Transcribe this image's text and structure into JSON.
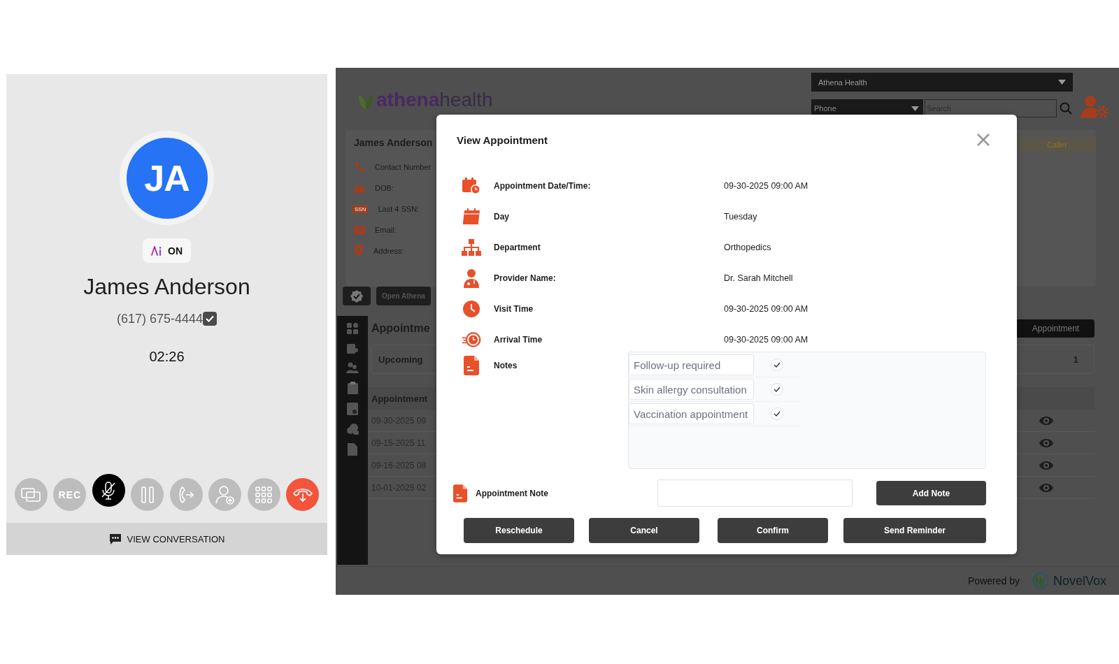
{
  "call_panel": {
    "initials": "JA",
    "ai_status": "ON",
    "caller_name": "James Anderson",
    "phone": "(617) 675-4444",
    "verified": true,
    "timer": "02:26",
    "controls": [
      {
        "kind": "screen",
        "active": false
      },
      {
        "kind": "record",
        "label": "REC",
        "active": false
      },
      {
        "kind": "mute",
        "active": true
      },
      {
        "kind": "hold",
        "active": false
      },
      {
        "kind": "transfer",
        "active": false
      },
      {
        "kind": "add_contact",
        "active": false
      },
      {
        "kind": "keypad",
        "active": false
      },
      {
        "kind": "hangup",
        "active": false
      }
    ],
    "view_conversation": "VIEW CONVERSATION"
  },
  "crm": {
    "logo": "**athena**health",
    "account_select": "Athena Health",
    "channel_select": "Phone",
    "search": {
      "placeholder": "Search"
    },
    "patient": {
      "name": "James Anderson",
      "fields": [
        {
          "kind": "phone",
          "label": "Contact Number"
        },
        {
          "kind": "dob",
          "label": "DOB:"
        },
        {
          "kind": "ssn",
          "label": "Last 4 SSN:",
          "badge": "SSN"
        },
        {
          "kind": "email",
          "label": "Email:"
        },
        {
          "kind": "address",
          "label": "Address:"
        }
      ]
    },
    "caller_tag": "Caller",
    "open_button": "Open Athena",
    "appointments": {
      "heading": "Appointme",
      "tab": "Upcoming",
      "count": "1",
      "new_button": "Appointment",
      "column_1": "Appointment",
      "rows": [
        {
          "column_1": "09-30-2025 09"
        },
        {
          "column_1": "09-15-2025 11"
        },
        {
          "column_1": "09-16-2025 08"
        },
        {
          "column_1": "10-01-2025 02"
        }
      ]
    },
    "footer": {
      "powered_by": "Powered by",
      "brand": "NovelVox"
    }
  },
  "modal": {
    "title": "View Appointment",
    "details": [
      {
        "kind": "datetime",
        "label": "Appointment Date/Time:",
        "value": "09-30-2025 09:00 AM"
      },
      {
        "kind": "day",
        "label": "Day",
        "value": "Tuesday"
      },
      {
        "kind": "department",
        "label": "Department",
        "value": "Orthopedics"
      },
      {
        "kind": "provider",
        "label": "Provider Name:",
        "value": "Dr. Sarah Mitchell"
      },
      {
        "kind": "visit",
        "label": "Visit Time",
        "value": "09-30-2025 09:00 AM"
      },
      {
        "kind": "arrival",
        "label": "Arrival Time",
        "value": "09-30-2025 09:00 AM"
      }
    ],
    "notes": {
      "label": "Notes",
      "items": [
        {
          "text": "Follow-up required",
          "checked": true
        },
        {
          "text": "Skin allergy consultation",
          "checked": true
        },
        {
          "text": "Vaccination appointment",
          "checked": true
        }
      ]
    },
    "appointment_note": {
      "label": "Appointment Note"
    },
    "add_note": "Add Note",
    "actions": [
      "Reschedule",
      "Cancel",
      "Confirm",
      "Send Reminder"
    ]
  }
}
